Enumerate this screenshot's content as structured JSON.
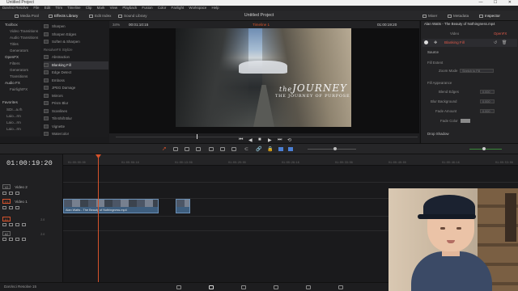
{
  "window": {
    "title": "Untitled Project",
    "buttons": "—  ☐  ✕"
  },
  "menu": [
    "DaVinci Resolve",
    "File",
    "Edit",
    "Trim",
    "Timeline",
    "Clip",
    "Mark",
    "View",
    "Playback",
    "Fusion",
    "Color",
    "Fairlight",
    "Workspace",
    "Help"
  ],
  "toolbar": {
    "media_pool": "Media Pool",
    "effects_library": "Effects Library",
    "edit_index": "Edit Index",
    "sound_library": "Sound Library",
    "project_title": "Untitled Project",
    "mixer": "Mixer",
    "metadata": "Metadata",
    "inspector": "Inspector"
  },
  "left_tree": {
    "items": [
      "Toolbox",
      "Video Transitions",
      "Audio Transitions",
      "Titles",
      "Generators",
      "OpenFX",
      "Filters",
      "Generators",
      "Transitions",
      "Audio FX",
      "FairlightFX"
    ],
    "favorites_label": "Favorites",
    "favorites": [
      "SDI...a.rh",
      "Laio...rm",
      "Laio...rm",
      "Laio...rm"
    ]
  },
  "effects_list": [
    {
      "label": "Sharpen",
      "type": "item"
    },
    {
      "label": "Sharpen Edges",
      "type": "item"
    },
    {
      "label": "Soften & Sharpen",
      "type": "item"
    },
    {
      "label": "ResolveFX Stylize",
      "type": "head"
    },
    {
      "label": "Abstraction",
      "type": "item"
    },
    {
      "label": "Blanking Fill",
      "type": "sel"
    },
    {
      "label": "Edge Detect",
      "type": "item"
    },
    {
      "label": "Emboss",
      "type": "item"
    },
    {
      "label": "JPEG Damage",
      "type": "item"
    },
    {
      "label": "Mirrors",
      "type": "item"
    },
    {
      "label": "Prism Blur",
      "type": "item"
    },
    {
      "label": "Scanlines",
      "type": "item"
    },
    {
      "label": "Tilt-Shift Blur",
      "type": "item"
    },
    {
      "label": "Vignette",
      "type": "item"
    },
    {
      "label": "Watercolor",
      "type": "item"
    }
  ],
  "viewer": {
    "zoom": "34%",
    "src_tc": "00:01:10:15",
    "timeline_name": "Timeline 1",
    "rec_tc": "01:00:19:20",
    "overlay_title": "JOURNEY",
    "overlay_title_prefix": "the",
    "overlay_sub": "THE JOURNEY OF PURPOSE"
  },
  "inspector": {
    "clip_name": "Alan Watts - The Beauty of Nothingness.mp4",
    "tab_video": "Video",
    "tab_openfx": "OpenFX",
    "effect": "Blanking Fill",
    "source": "Source",
    "fill_extent": "Fill Extent",
    "zoom_mode_label": "Zoom Mode",
    "zoom_mode_value": "Stretch to Fill",
    "fill_appearance": "Fill Appearance",
    "blend_edges": "Blend Edges",
    "blend_edges_val": "0.000",
    "blur_bg": "Blur Background",
    "blur_bg_val": "0.000",
    "fade_amount": "Fade Amount",
    "fade_amount_val": "0.000",
    "fade_color": "Fade Color",
    "drop_shadow": "Drop Shadow"
  },
  "timeline": {
    "timecode": "01:00:19:20",
    "ruler": [
      "01:00:00:00",
      "01:00:06:16",
      "01:00:13:08",
      "01:00:20:00",
      "01:00:26:16",
      "01:00:33:08",
      "01:00:40:00",
      "01:00:46:16",
      "01:00:53:08"
    ],
    "tracks": [
      {
        "id": "V2",
        "name": "Video 2"
      },
      {
        "id": "V1",
        "name": "Video 1"
      },
      {
        "id": "A1",
        "name": "",
        "level": "2.0"
      },
      {
        "id": "A2",
        "name": "",
        "level": "2.0"
      }
    ],
    "clip_label": "Alan Watts - The Beauty of Nothingness.mp4"
  },
  "app_name": "DaVinci Resolve 15",
  "colors": {
    "accent_orange": "#d6532c",
    "clip_blue": "#3e5e7e",
    "selected_red": "#e05a4a"
  }
}
